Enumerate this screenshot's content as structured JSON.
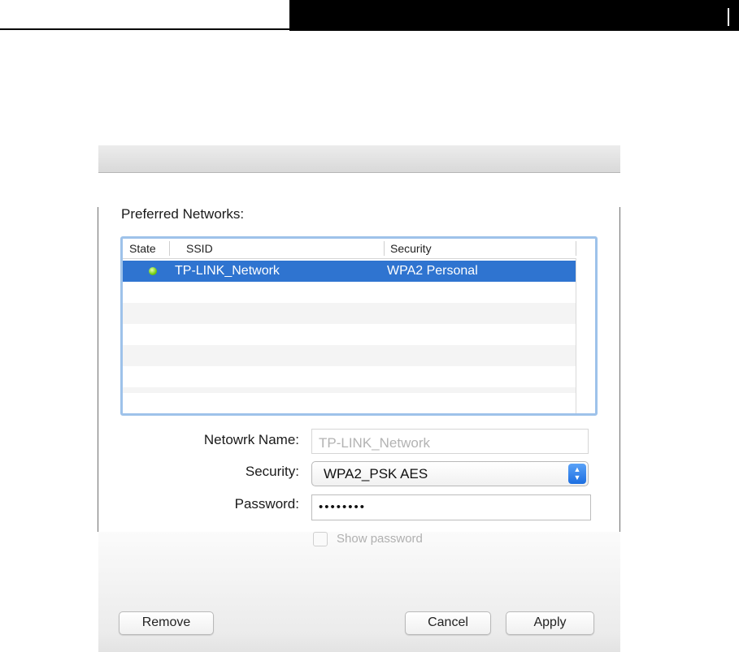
{
  "window": {
    "section_title": "Preferred Networks:"
  },
  "table": {
    "columns": [
      "State",
      "SSID",
      "Security"
    ],
    "rows": [
      {
        "state_icon": "green-dot-icon",
        "ssid": "TP-LINK_Network",
        "security": "WPA2 Personal",
        "selected": true
      }
    ]
  },
  "form": {
    "network_name_label": "Netowrk Name:",
    "network_name_value": "TP-LINK_Network",
    "security_label": "Security:",
    "security_value": "WPA2_PSK AES",
    "password_label": "Password:",
    "password_value": "••••••••",
    "show_password_label": "Show password"
  },
  "buttons": {
    "remove": "Remove",
    "cancel": "Cancel",
    "apply": "Apply"
  },
  "colors": {
    "selection": "#2f74d0",
    "table_focus_border": "#9ec2ea",
    "state_green": "#7bd318",
    "select_accent": "#1d6fe1"
  }
}
